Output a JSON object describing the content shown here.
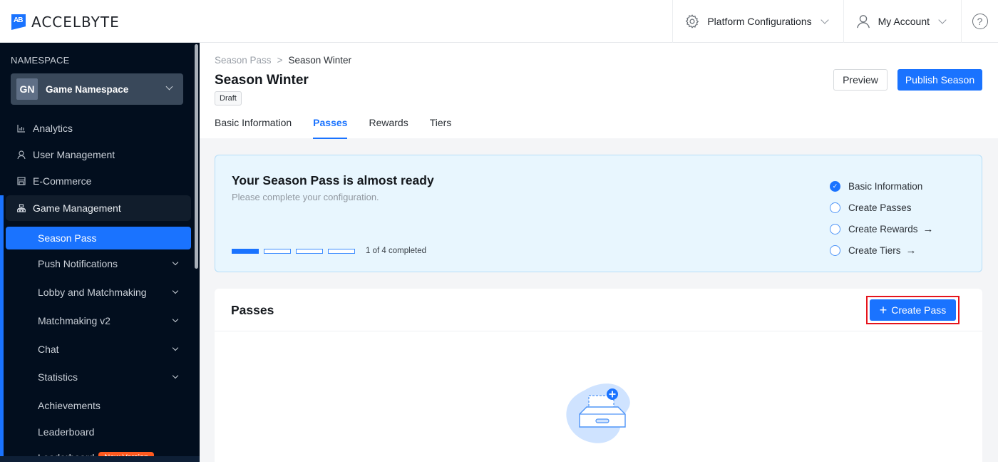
{
  "brand": {
    "logo_mark": "AB",
    "name": "ACCELBYTE"
  },
  "topnav": {
    "platform_config": {
      "icon": "gear-icon",
      "label": "Platform Configurations"
    },
    "account": {
      "icon": "user-icon",
      "label": "My Account"
    },
    "help": {
      "icon": "help-icon",
      "glyph": "?"
    }
  },
  "sidebar": {
    "namespace_label": "NAMESPACE",
    "namespace": {
      "initials": "GN",
      "name": "Game Namespace"
    },
    "items": [
      {
        "icon": "bar-chart-icon",
        "label": "Analytics"
      },
      {
        "icon": "user-icon",
        "label": "User Management"
      },
      {
        "icon": "store-icon",
        "label": "E-Commerce"
      },
      {
        "icon": "hierarchy-icon",
        "label": "Game Management"
      }
    ],
    "sub_items": [
      {
        "label": "Season Pass",
        "active": true,
        "expandable": false
      },
      {
        "label": "Push Notifications",
        "expandable": true
      },
      {
        "label": "Lobby and Matchmaking",
        "expandable": true
      },
      {
        "label": "Matchmaking v2",
        "expandable": true
      },
      {
        "label": "Chat",
        "expandable": true
      },
      {
        "label": "Statistics",
        "expandable": true
      },
      {
        "label": "Achievements",
        "expandable": false
      },
      {
        "label": "Leaderboard",
        "expandable": false
      },
      {
        "label": "Leaderboard",
        "badge": "New Version",
        "expandable": false
      }
    ]
  },
  "page": {
    "breadcrumb": {
      "parent": "Season Pass",
      "separator": ">",
      "current": "Season Winter"
    },
    "title": "Season Winter",
    "status": "Draft",
    "actions": {
      "preview": "Preview",
      "publish": "Publish Season"
    },
    "tabs": [
      {
        "label": "Basic Information",
        "active": false
      },
      {
        "label": "Passes",
        "active": true
      },
      {
        "label": "Rewards",
        "active": false
      },
      {
        "label": "Tiers",
        "active": false
      }
    ]
  },
  "setup": {
    "title": "Your Season Pass is almost ready",
    "subtitle": "Please complete your configuration.",
    "progress": {
      "completed": 1,
      "total": 4,
      "text": "1 of 4 completed"
    },
    "checklist": [
      {
        "label": "Basic Information",
        "done": true,
        "arrow": false
      },
      {
        "label": "Create Passes",
        "done": false,
        "arrow": false
      },
      {
        "label": "Create Rewards",
        "done": false,
        "arrow": true
      },
      {
        "label": "Create Tiers",
        "done": false,
        "arrow": true
      }
    ]
  },
  "passes": {
    "title": "Passes",
    "create_button": "Create Pass",
    "create_icon": "plus-icon",
    "empty_illustration": "empty-box-icon"
  },
  "colors": {
    "accent": "#1a73ff",
    "sidebar_bg": "#020e1e",
    "badge": "#ff5a1f",
    "highlight": "#e5141d"
  }
}
